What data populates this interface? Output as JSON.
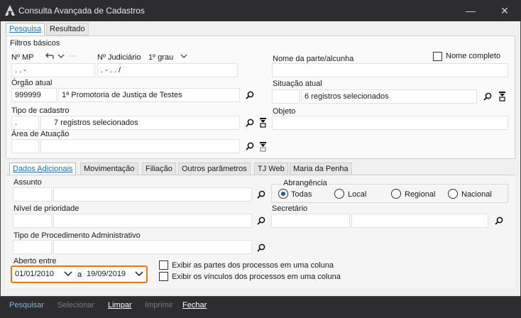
{
  "window": {
    "title": "Consulta Avançada de Cadastros"
  },
  "main_tabs": [
    {
      "label": "Pesquisa"
    },
    {
      "label": "Resultado"
    }
  ],
  "filtros_basicos": {
    "legend": "Filtros básicos",
    "nmp": {
      "label": "Nº MP",
      "value": ". . -"
    },
    "nj": {
      "label": "Nº Judiciário",
      "value": ". - . . /",
      "grau": "1º grau"
    },
    "nome_parte": {
      "label": "Nome da parte/alcunha",
      "value": ""
    },
    "nome_completo": {
      "label": "Nome completo",
      "checked": false
    },
    "orgao": {
      "label": "Órgão atual",
      "code": "999999",
      "value": "1ª Promotoria de Justiça de Testes"
    },
    "situacao": {
      "label": "Situação atual",
      "code": "",
      "value": "6 registros selecionados"
    },
    "tipo_cadastro": {
      "label": "Tipo de cadastro",
      "code": ".",
      "value": "7 registros selecionados"
    },
    "objeto": {
      "label": "Objeto",
      "value": ""
    },
    "area": {
      "label": "Área de Atuação",
      "code": "",
      "value": ""
    }
  },
  "sub_tabs": [
    {
      "label": "Dados Adicionais"
    },
    {
      "label": "Movimentação"
    },
    {
      "label": "Filiação"
    },
    {
      "label": "Outros parâmetros"
    },
    {
      "label": "TJ Web"
    },
    {
      "label": "Maria da Penha"
    }
  ],
  "dados": {
    "assunto": {
      "label": "Assunto"
    },
    "abrangencia": {
      "legend": "Abrangência",
      "options": [
        {
          "label": "Todas"
        },
        {
          "label": "Local"
        },
        {
          "label": "Regional"
        },
        {
          "label": "Nacional"
        }
      ],
      "selected": "Todas"
    },
    "nivel": {
      "label": "Nível de prioridade"
    },
    "secretario": {
      "label": "Secretário"
    },
    "tipo_proc": {
      "label": "Tipo de Procedimento Administrativo"
    },
    "aberto": {
      "label": "Aberto entre",
      "from": "01/01/2010",
      "sep": "a",
      "to": "19/09/2019"
    },
    "exibir_partes": {
      "label": "Exibir as partes dos processos em uma coluna",
      "checked": false
    },
    "exibir_vinculos": {
      "label": "Exibir os vínculos dos processos em uma coluna",
      "checked": false
    }
  },
  "footer": {
    "pesquisar": "Pesquisar",
    "selecionar": "Selecionar",
    "limpar": "Limpar",
    "imprimir": "Imprimir",
    "fechar": "Fechar"
  }
}
